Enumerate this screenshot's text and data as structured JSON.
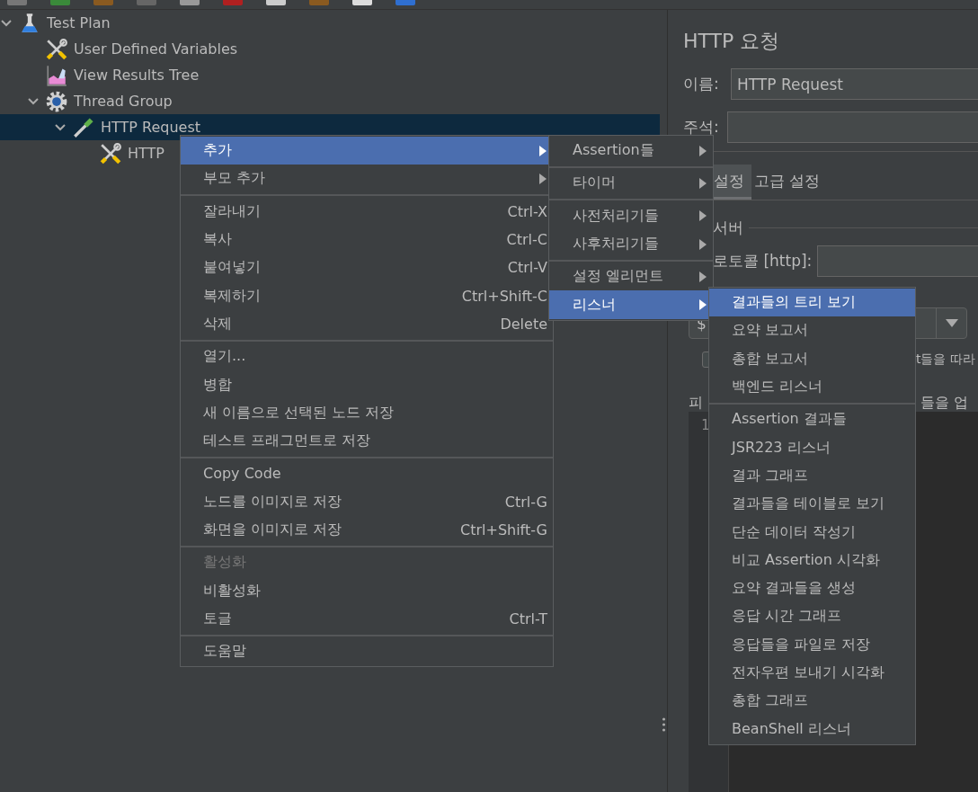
{
  "tree": [
    {
      "label": "Test Plan",
      "kind": "test_plan",
      "expanded": true,
      "selected": false,
      "children": [
        {
          "label": "User Defined Variables",
          "kind": "config",
          "selected": false
        },
        {
          "label": "View Results Tree",
          "kind": "listener",
          "selected": false
        },
        {
          "label": "Thread Group",
          "kind": "thread_group",
          "expanded": true,
          "selected": false,
          "children": [
            {
              "label": "HTTP Request",
              "kind": "sampler",
              "expanded": true,
              "selected": true,
              "children": [
                {
                  "label": "HTTP",
                  "kind": "config",
                  "selected": false
                }
              ]
            }
          ]
        }
      ]
    }
  ],
  "panel": {
    "title": "HTTP 요청",
    "name_label": "이름:",
    "name_value": "HTTP Request",
    "comment_label": "주석:",
    "tabs": [
      {
        "label": "설정",
        "selected": true
      },
      {
        "label": "고급 설정",
        "selected": false
      }
    ],
    "group_label": "서버",
    "protocol_label": "로토콜 [http]:",
    "method_value": "$",
    "checkbox_checked": false,
    "checkbox_text": "t들을 따라",
    "files_label": "피",
    "files_text": "들을 업",
    "editor_line": "1"
  },
  "context_menu": {
    "items": [
      {
        "kind": "submenu",
        "label": "추가",
        "selected": true,
        "disabled": false
      },
      {
        "kind": "submenu",
        "label": "부모 추가",
        "selected": false,
        "disabled": false
      },
      {
        "kind": "separator"
      },
      {
        "kind": "item",
        "label": "잘라내기",
        "shortcut": "Ctrl-X",
        "selected": false,
        "disabled": false
      },
      {
        "kind": "item",
        "label": "복사",
        "shortcut": "Ctrl-C",
        "selected": false,
        "disabled": false
      },
      {
        "kind": "item",
        "label": "붙여넣기",
        "shortcut": "Ctrl-V",
        "selected": false,
        "disabled": false
      },
      {
        "kind": "item",
        "label": "복제하기",
        "shortcut": "Ctrl+Shift-C",
        "selected": false,
        "disabled": false
      },
      {
        "kind": "item",
        "label": "삭제",
        "shortcut": "Delete",
        "selected": false,
        "disabled": false
      },
      {
        "kind": "separator"
      },
      {
        "kind": "item",
        "label": "열기...",
        "selected": false,
        "disabled": false
      },
      {
        "kind": "item",
        "label": "병합",
        "selected": false,
        "disabled": false
      },
      {
        "kind": "item",
        "label": "새 이름으로 선택된 노드 저장",
        "selected": false,
        "disabled": false
      },
      {
        "kind": "item",
        "label": "테스트 프래그먼트로 저장",
        "selected": false,
        "disabled": false
      },
      {
        "kind": "separator"
      },
      {
        "kind": "item",
        "label": "Copy Code",
        "selected": false,
        "disabled": false
      },
      {
        "kind": "item",
        "label": "노드를 이미지로 저장",
        "shortcut": "Ctrl-G",
        "selected": false,
        "disabled": false
      },
      {
        "kind": "item",
        "label": "화면을 이미지로 저장",
        "shortcut": "Ctrl+Shift-G",
        "selected": false,
        "disabled": false
      },
      {
        "kind": "separator"
      },
      {
        "kind": "item",
        "label": "활성화",
        "selected": false,
        "disabled": true
      },
      {
        "kind": "item",
        "label": "비활성화",
        "selected": false,
        "disabled": false
      },
      {
        "kind": "item",
        "label": "토글",
        "shortcut": "Ctrl-T",
        "selected": false,
        "disabled": false
      },
      {
        "kind": "separator"
      },
      {
        "kind": "item",
        "label": "도움말",
        "selected": false,
        "disabled": false
      }
    ]
  },
  "add_submenu": {
    "items": [
      {
        "kind": "submenu",
        "label": "Assertion들",
        "selected": false
      },
      {
        "kind": "separator"
      },
      {
        "kind": "submenu",
        "label": "타이머",
        "selected": false
      },
      {
        "kind": "separator"
      },
      {
        "kind": "submenu",
        "label": "사전처리기들",
        "selected": false
      },
      {
        "kind": "submenu",
        "label": "사후처리기들",
        "selected": false
      },
      {
        "kind": "separator"
      },
      {
        "kind": "submenu",
        "label": "설정 엘리먼트",
        "selected": false
      },
      {
        "kind": "submenu",
        "label": "리스너",
        "selected": true
      }
    ]
  },
  "listener_submenu": {
    "items": [
      {
        "kind": "item",
        "label": "결과들의 트리 보기",
        "selected": true
      },
      {
        "kind": "item",
        "label": "요약 보고서",
        "selected": false
      },
      {
        "kind": "item",
        "label": "총합 보고서",
        "selected": false
      },
      {
        "kind": "item",
        "label": "백엔드 리스너",
        "selected": false
      },
      {
        "kind": "separator"
      },
      {
        "kind": "item",
        "label": "Assertion 결과들",
        "selected": false
      },
      {
        "kind": "item",
        "label": "JSR223 리스너",
        "selected": false
      },
      {
        "kind": "item",
        "label": "결과 그래프",
        "selected": false
      },
      {
        "kind": "item",
        "label": "결과들을 테이블로 보기",
        "selected": false
      },
      {
        "kind": "item",
        "label": "단순 데이터 작성기",
        "selected": false
      },
      {
        "kind": "item",
        "label": "비교 Assertion 시각화",
        "selected": false
      },
      {
        "kind": "item",
        "label": "요약 결과들을 생성",
        "selected": false
      },
      {
        "kind": "item",
        "label": "응답 시간 그래프",
        "selected": false
      },
      {
        "kind": "item",
        "label": "응답들을 파일로 저장",
        "selected": false
      },
      {
        "kind": "item",
        "label": "전자우편 보내기 시각화",
        "selected": false
      },
      {
        "kind": "item",
        "label": "총합 그래프",
        "selected": false
      },
      {
        "kind": "item",
        "label": "BeanShell 리스너",
        "selected": false
      }
    ]
  }
}
